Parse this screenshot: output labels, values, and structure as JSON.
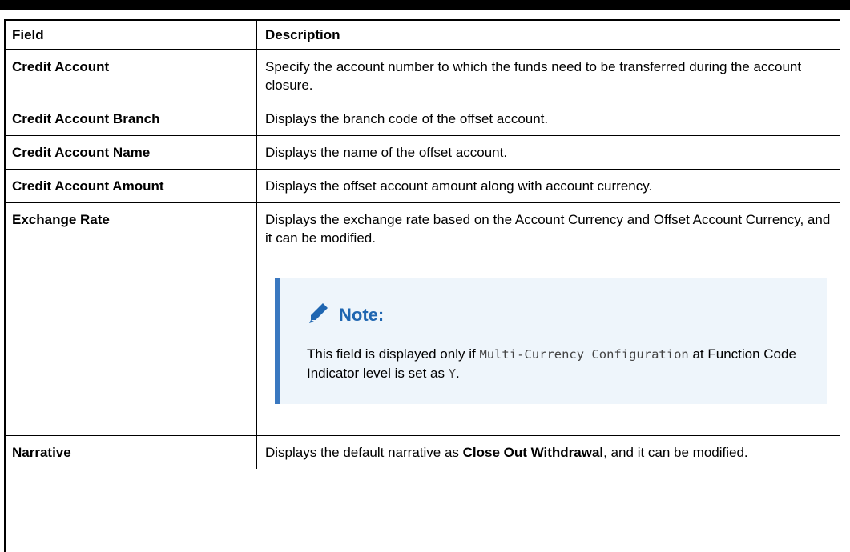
{
  "table": {
    "headers": {
      "field": "Field",
      "description": "Description"
    },
    "rows": [
      {
        "field": "Credit Account",
        "description": "Specify the account number to which the funds need to be transferred during the account closure."
      },
      {
        "field": "Credit Account Branch",
        "description": "Displays the branch code of the offset account."
      },
      {
        "field": "Credit Account Name",
        "description": "Displays the name of the offset account."
      },
      {
        "field": "Credit Account Amount",
        "description": "Displays the offset account amount along with account currency."
      },
      {
        "field": "Exchange Rate",
        "description": "Displays the exchange rate based on the Account Currency and Offset Account Currency, and it can be modified.",
        "note": {
          "title": "Note:",
          "text_before": "This field is displayed only if ",
          "code1": "Multi-Currency Configuration",
          "text_middle": " at Function Code Indicator level is set as ",
          "code2": "Y",
          "text_after": "."
        }
      },
      {
        "field": "Narrative",
        "description_before": "Displays the default narrative as ",
        "description_bold": "Close Out Withdrawal",
        "description_after": ", and it can be modified."
      }
    ]
  },
  "colors": {
    "note_accent": "#3a78c0",
    "note_title": "#1f66b1",
    "note_bg": "#eef5fb"
  },
  "icons": {
    "note_icon": "pencil-icon"
  }
}
